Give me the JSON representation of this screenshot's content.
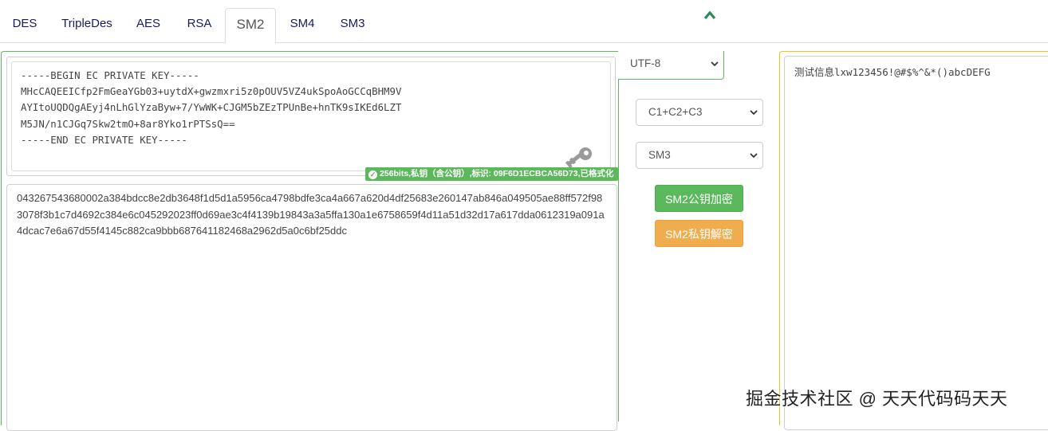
{
  "tabs": [
    {
      "label": "DES"
    },
    {
      "label": "TripleDes"
    },
    {
      "label": "AES"
    },
    {
      "label": "RSA"
    },
    {
      "label": "SM2",
      "active": true
    },
    {
      "label": "SM4"
    },
    {
      "label": "SM3"
    }
  ],
  "key": {
    "text": "-----BEGIN EC PRIVATE KEY-----\nMHcCAQEEICfp2FmGeaYGb03+uytdX+gwzmxri5z0pOUV5VZ4ukSpoAoGCCqBHM9V\nAYItoUQDQgAEyj4nLhGlYzaByw+7/YwWK+CJGM5bZEzTPUnBe+hnTK9sIKEd6LZT\nM5JN/n1CJGq7Skw2tmO+8ar8Yko1rPTSsQ==\n-----END EC PRIVATE KEY-----",
    "badge": "256bits,私钥（含公钥）,标识: 09F6D1ECBCA56D73,已格式化"
  },
  "cipher": {
    "text": "043267543680002a384bdcc8e2db3648f1d5d1a5956ca4798bdfe3ca4a667a620d4df25683e260147ab846a049505ae88ff572f983078f3b1c7d4692c384e6c045292023ff0d69ae3c4f4139b19843a3a5ffa130a1e6758659f4d11a51d32d17a617dda0612319a091a4dcac7e6a67d55f4145c882ca9bbb687641182468a2962d5a0c6bf25ddc"
  },
  "controls": {
    "charset": "UTF-8",
    "mode": "C1+C2+C3",
    "hash": "SM3",
    "encrypt_label": "SM2公钥加密",
    "decrypt_label": "SM2私钥解密"
  },
  "plain": {
    "text": "测试信息lxw123456!@#$%^&*()abcDEFG"
  },
  "watermark": "掘金技术社区 @ 天天代码码天天",
  "colors": {
    "accent_green": "#5cb85c",
    "accent_orange": "#f0ad4e",
    "right_border": "#f0c419"
  }
}
